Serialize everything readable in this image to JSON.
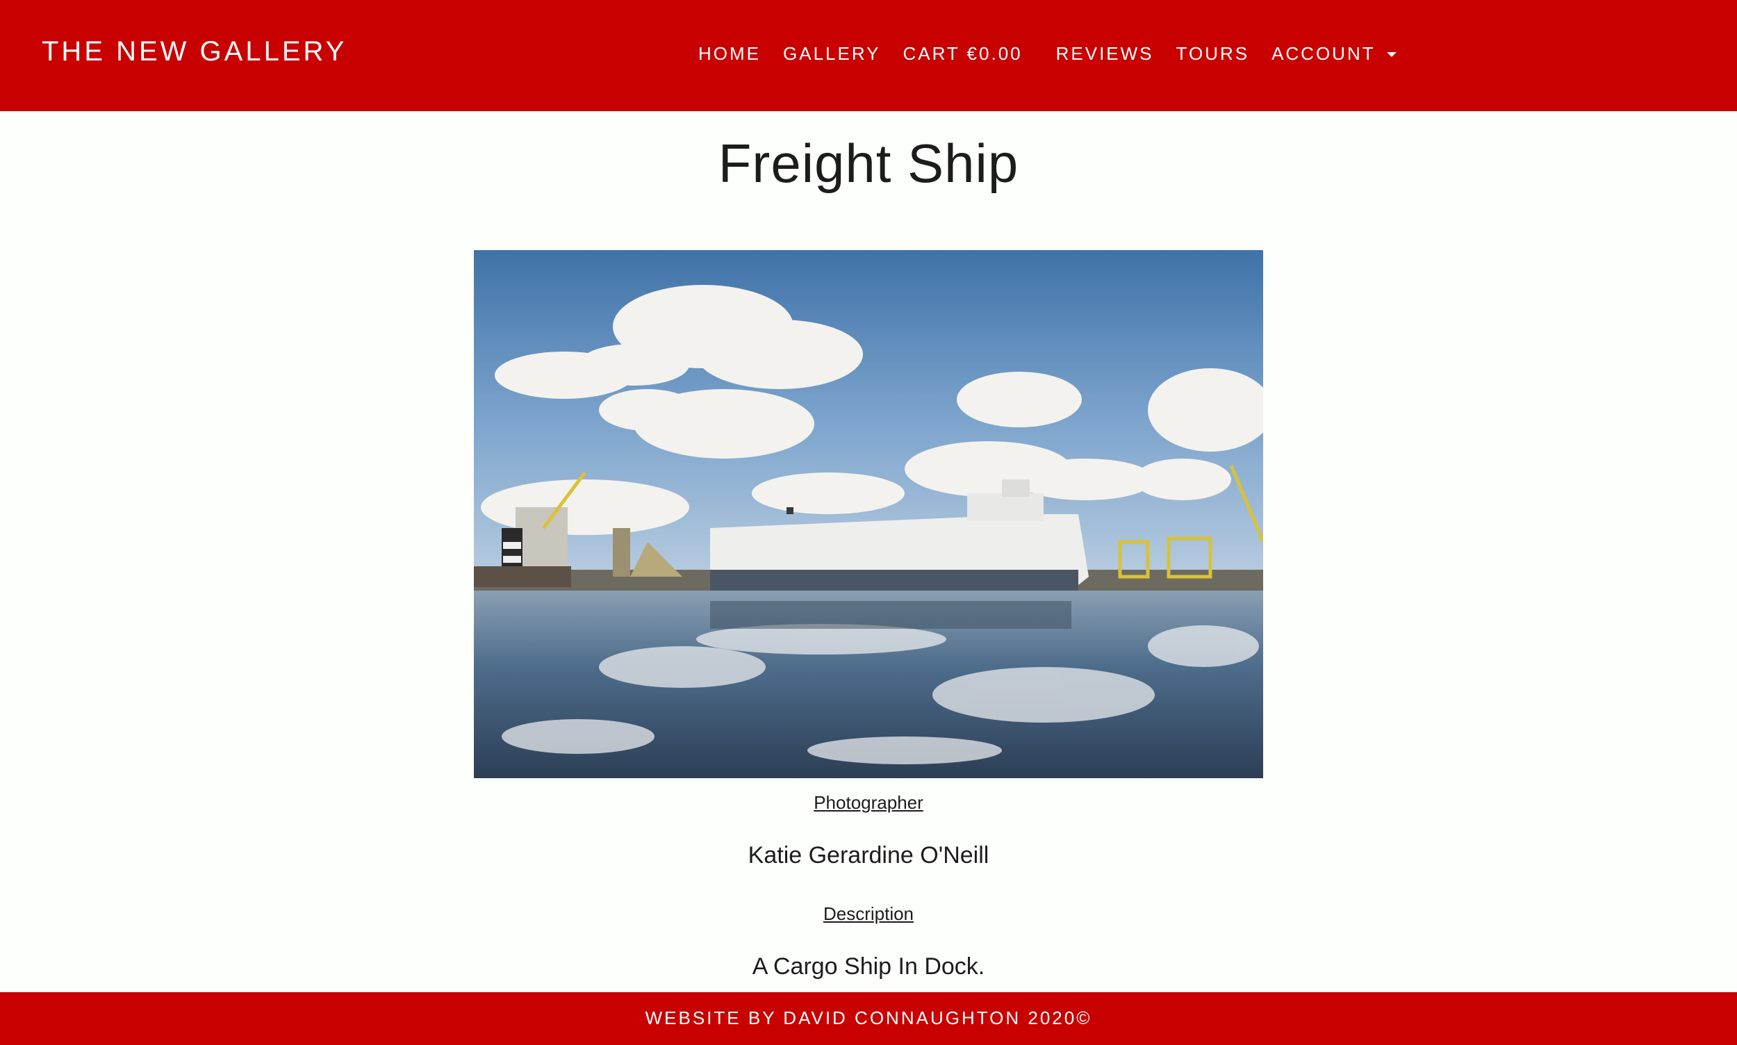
{
  "header": {
    "brand": "THE NEW GALLERY",
    "nav": {
      "home": "HOME",
      "gallery": "GALLERY",
      "cart": "CART €0.00",
      "reviews": "REVIEWS",
      "tours": "TOURS",
      "account": "ACCOUNT"
    }
  },
  "main": {
    "title": "Freight Ship",
    "photographer_label": "Photographer",
    "photographer": "Katie Gerardine O'Neill",
    "description_label": "Description",
    "description": "A Cargo Ship In Dock."
  },
  "footer": {
    "text": "WEBSITE BY DAVID CONNAUGHTON 2020©"
  },
  "colors": {
    "brand_red": "#c80000",
    "background": "#fdfffd",
    "text": "#1c1c1c"
  }
}
